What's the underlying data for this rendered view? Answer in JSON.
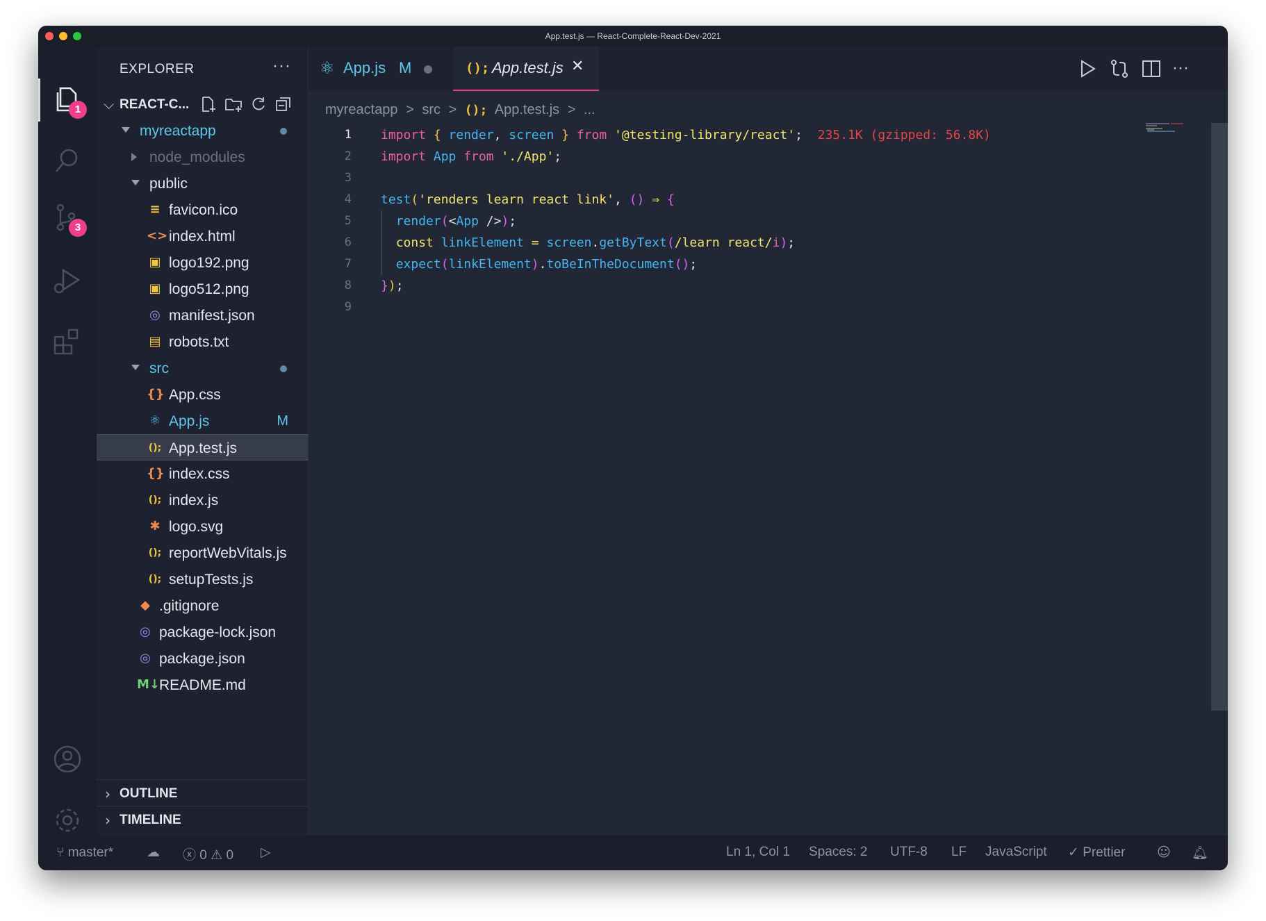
{
  "window": {
    "title": "App.test.js — React-Complete-React-Dev-2021"
  },
  "activity": {
    "explorer_badge": "1",
    "scm_badge": "3"
  },
  "sidebar": {
    "title": "EXPLORER",
    "more": "···",
    "project": "REACT-C...",
    "tree": [
      {
        "name": "myreactapp",
        "depth": 0,
        "type": "folder-open",
        "color": "#5cc8e8",
        "dot": true
      },
      {
        "name": "node_modules",
        "depth": 1,
        "type": "folder-closed",
        "color": "#6b7080"
      },
      {
        "name": "public",
        "depth": 1,
        "type": "folder-open",
        "color": "#e4e7ee"
      },
      {
        "name": "favicon.ico",
        "depth": 2,
        "icon": "≡",
        "icolor": "#f3c53b"
      },
      {
        "name": "index.html",
        "depth": 2,
        "icon": "<>",
        "icolor": "#f08a4b"
      },
      {
        "name": "logo192.png",
        "depth": 2,
        "icon": "▣",
        "icolor": "#f3c53b"
      },
      {
        "name": "logo512.png",
        "depth": 2,
        "icon": "▣",
        "icolor": "#f3c53b"
      },
      {
        "name": "manifest.json",
        "depth": 2,
        "icon": "◎",
        "icolor": "#9b8cf0"
      },
      {
        "name": "robots.txt",
        "depth": 2,
        "icon": "▤",
        "icolor": "#f3c53b"
      },
      {
        "name": "src",
        "depth": 1,
        "type": "folder-open",
        "color": "#5cc8e8",
        "dot": true
      },
      {
        "name": "App.css",
        "depth": 2,
        "icon": "{}",
        "icolor": "#f08a4b"
      },
      {
        "name": "App.js",
        "depth": 2,
        "icon": "⚛",
        "icolor": "#5cc8e8",
        "color": "#5cc8e8",
        "flag": "M"
      },
      {
        "name": "App.test.js",
        "depth": 2,
        "icon": "();",
        "icolor": "#f3c53b",
        "selected": true
      },
      {
        "name": "index.css",
        "depth": 2,
        "icon": "{}",
        "icolor": "#f08a4b"
      },
      {
        "name": "index.js",
        "depth": 2,
        "icon": "();",
        "icolor": "#f3c53b"
      },
      {
        "name": "logo.svg",
        "depth": 2,
        "icon": "✱",
        "icolor": "#f08a4b"
      },
      {
        "name": "reportWebVitals.js",
        "depth": 2,
        "icon": "();",
        "icolor": "#f3c53b"
      },
      {
        "name": "setupTests.js",
        "depth": 2,
        "icon": "();",
        "icolor": "#f3c53b"
      },
      {
        "name": ".gitignore",
        "depth": 1,
        "icon": "◆",
        "icolor": "#f08a4b"
      },
      {
        "name": "package-lock.json",
        "depth": 1,
        "icon": "◎",
        "icolor": "#9b8cf0"
      },
      {
        "name": "package.json",
        "depth": 1,
        "icon": "◎",
        "icolor": "#9b8cf0"
      },
      {
        "name": "README.md",
        "depth": 1,
        "icon": "M↓",
        "icolor": "#6fd07a"
      }
    ],
    "panels": [
      "OUTLINE",
      "TIMELINE"
    ]
  },
  "tabs": [
    {
      "label": "App.js",
      "flag": "M",
      "icon": "react-icon"
    },
    {
      "label": "App.test.js",
      "icon": "js-icon",
      "close": "✕"
    }
  ],
  "breadcrumb": [
    "myreactapp",
    ">",
    "src",
    ">",
    "();",
    "App.test.js",
    ">",
    "..."
  ],
  "code": {
    "lines": [
      [
        [
          "k",
          "import "
        ],
        [
          "b1",
          "{ "
        ],
        [
          "f",
          "render"
        ],
        [
          "p",
          ", "
        ],
        [
          "f",
          "screen"
        ],
        [
          "b1",
          " }"
        ],
        [
          "k",
          " from "
        ],
        [
          "s",
          "'@testing-library/react'"
        ],
        [
          "p",
          ";"
        ],
        [
          "size",
          "  235.1K (gzipped: 56.8K)"
        ]
      ],
      [
        [
          "k",
          "import "
        ],
        [
          "f",
          "App"
        ],
        [
          "k",
          " from "
        ],
        [
          "s",
          "'./App'"
        ],
        [
          "p",
          ";"
        ]
      ],
      [],
      [
        [
          "f",
          "test"
        ],
        [
          "b1",
          "("
        ],
        [
          "s",
          "'renders learn react link'"
        ],
        [
          "p",
          ", "
        ],
        [
          "b2",
          "()"
        ],
        [
          "op",
          " ⇒ "
        ],
        [
          "b2",
          "{"
        ]
      ],
      [
        [
          "p",
          "  "
        ],
        [
          "f",
          "render"
        ],
        [
          "b2",
          "("
        ],
        [
          "p",
          "<"
        ],
        [
          "f",
          "App"
        ],
        [
          "p",
          " />"
        ],
        [
          "b2",
          ")"
        ],
        [
          "p",
          ";"
        ]
      ],
      [
        [
          "p",
          "  "
        ],
        [
          "cst",
          "const "
        ],
        [
          "f",
          "linkElement"
        ],
        [
          "op",
          " = "
        ],
        [
          "f",
          "screen"
        ],
        [
          "p",
          "."
        ],
        [
          "f",
          "getByText"
        ],
        [
          "b2",
          "("
        ],
        [
          "s",
          "/learn react/"
        ],
        [
          "k",
          "i"
        ],
        [
          "b2",
          ")"
        ],
        [
          "p",
          ";"
        ]
      ],
      [
        [
          "p",
          "  "
        ],
        [
          "f",
          "expect"
        ],
        [
          "b2",
          "("
        ],
        [
          "f",
          "linkElement"
        ],
        [
          "b2",
          ")"
        ],
        [
          "p",
          "."
        ],
        [
          "f",
          "toBeInTheDocument"
        ],
        [
          "b2",
          "()"
        ],
        [
          "p",
          ";"
        ]
      ],
      [
        [
          "b2",
          "}"
        ],
        [
          "b1",
          ")"
        ],
        [
          "p",
          ";"
        ]
      ],
      []
    ]
  },
  "status": {
    "branch": "master*",
    "errors": "0",
    "warnings": "0",
    "position": "Ln 1, Col 1",
    "spaces": "Spaces: 2",
    "encoding": "UTF-8",
    "eol": "LF",
    "language": "JavaScript",
    "formatter": "Prettier"
  }
}
